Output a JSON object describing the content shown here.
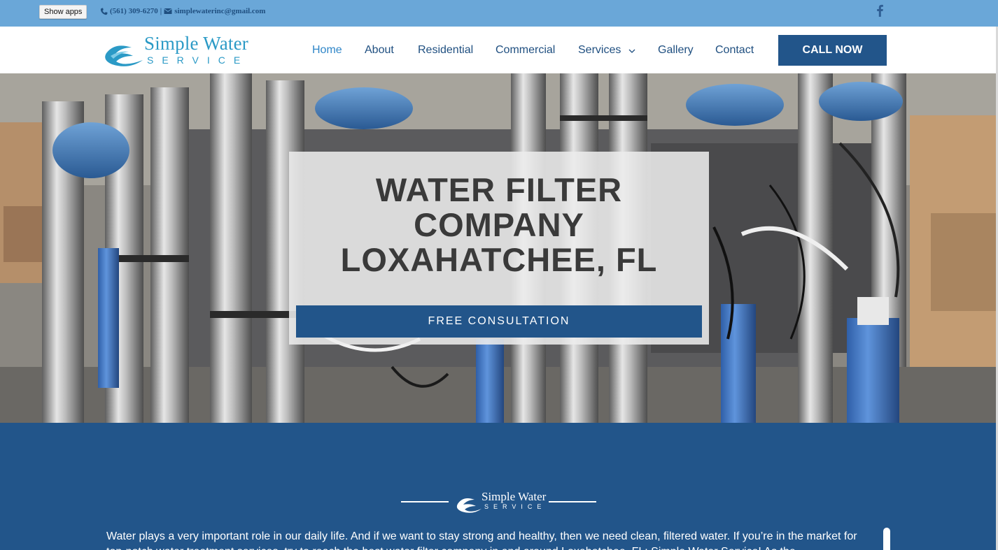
{
  "topbar": {
    "show_apps": "Show apps",
    "phone": "(561) 309-6270",
    "separator": "|",
    "email": "simplewaterinc@gmail.com",
    "phone_icon": "phone-icon",
    "email_icon": "envelope-icon",
    "social_icon": "facebook-icon"
  },
  "logo": {
    "title": "Simple Water",
    "subtitle": "SERVICE"
  },
  "nav": {
    "items": [
      "Home",
      "About",
      "Residential",
      "Commercial",
      "Services",
      "Gallery",
      "Contact"
    ],
    "call_button": "CALL NOW",
    "services_icon": "chevron-down-icon"
  },
  "hero": {
    "title_lines": [
      "WATER FILTER",
      "COMPANY",
      "LOXAHATCHEE, FL"
    ],
    "cta": "FREE CONSULTATION"
  },
  "section": {
    "logo_title": "Simple Water",
    "logo_subtitle": "SERVICE",
    "paragraph": "Water plays a very important role in our daily life. And if we want to stay strong and healthy, then we need clean, filtered water. If you’re in the market for top-notch water treatment services, try to reach the best water filter company in and around Loxahatchee, FL: Simple Water Service! As the"
  },
  "colors": {
    "topbar": "#6aa7d8",
    "brand_blue": "#22558a",
    "logo_teal": "#2b9ac6",
    "nav_text": "#1f4f80",
    "nav_active": "#2f86c8"
  }
}
